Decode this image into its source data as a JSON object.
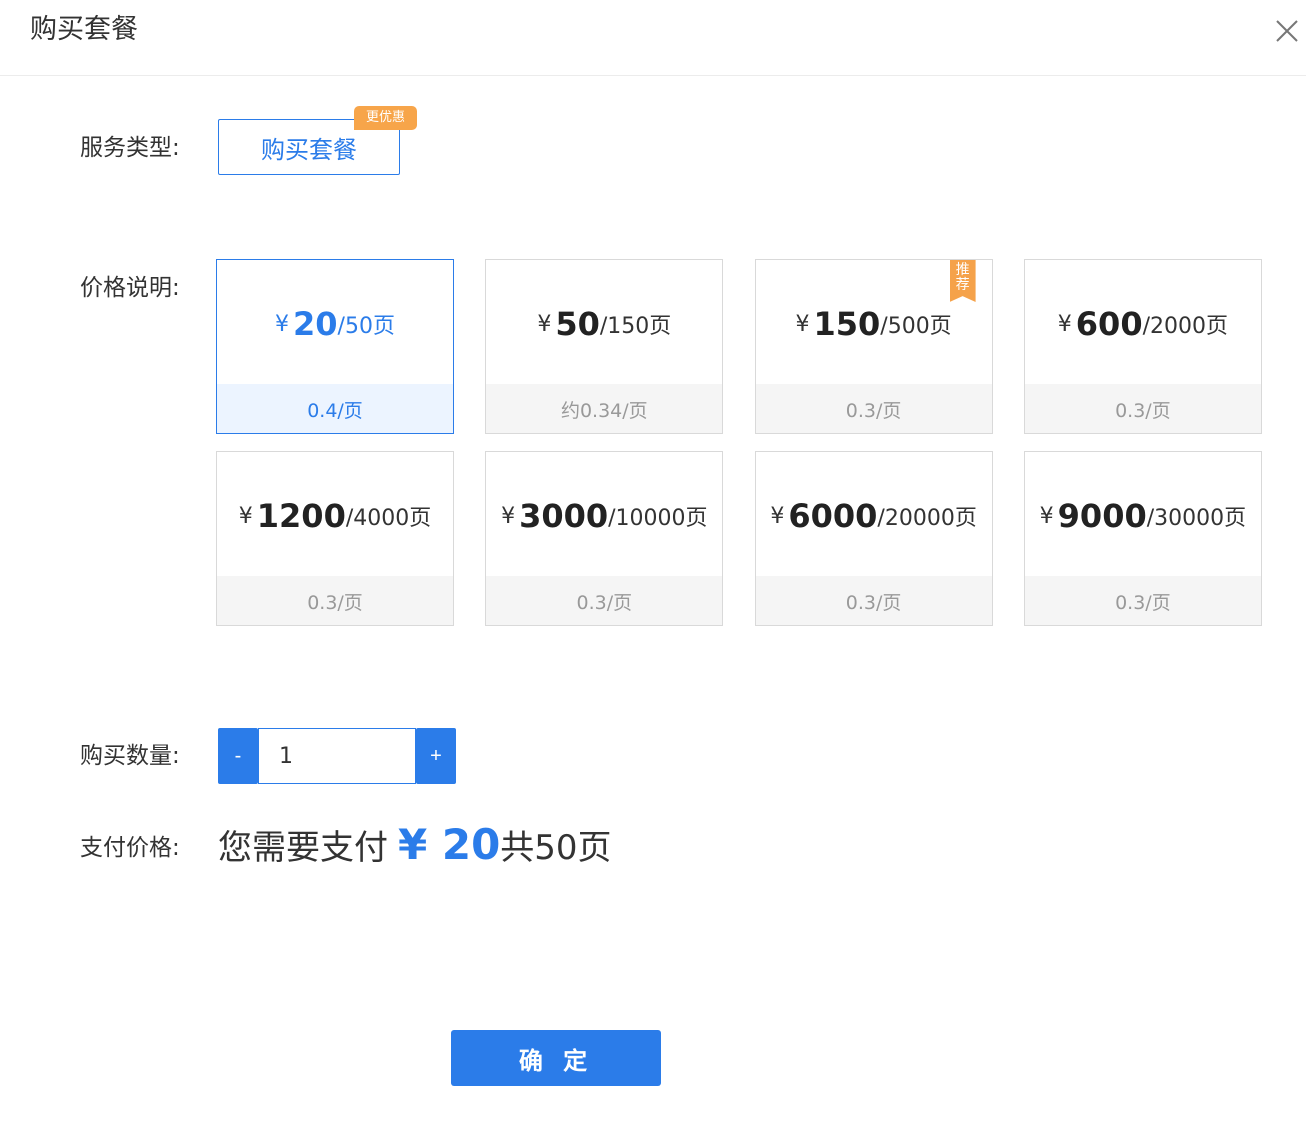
{
  "dialog": {
    "title": "购买套餐",
    "close_icon": "close-icon"
  },
  "service": {
    "label": "服务类型:",
    "button_label": "购买套餐",
    "badge": "更优惠"
  },
  "pricing": {
    "label": "价格说明:",
    "currency": "¥",
    "packages": [
      {
        "price": "20",
        "pages": "/50页",
        "unit": "0.4/页",
        "selected": true,
        "badge": ""
      },
      {
        "price": "50",
        "pages": "/150页",
        "unit": "约0.34/页",
        "selected": false,
        "badge": ""
      },
      {
        "price": "150",
        "pages": "/500页",
        "unit": "0.3/页",
        "selected": false,
        "badge": "推荐"
      },
      {
        "price": "600",
        "pages": "/2000页",
        "unit": "0.3/页",
        "selected": false,
        "badge": ""
      },
      {
        "price": "1200",
        "pages": "/4000页",
        "unit": "0.3/页",
        "selected": false,
        "badge": ""
      },
      {
        "price": "3000",
        "pages": "/10000页",
        "unit": "0.3/页",
        "selected": false,
        "badge": ""
      },
      {
        "price": "6000",
        "pages": "/20000页",
        "unit": "0.3/页",
        "selected": false,
        "badge": ""
      },
      {
        "price": "9000",
        "pages": "/30000页",
        "unit": "0.3/页",
        "selected": false,
        "badge": ""
      }
    ]
  },
  "quantity": {
    "label": "购买数量:",
    "minus": "-",
    "plus": "+",
    "value": "1"
  },
  "payment": {
    "label": "支付价格:",
    "prefix": "您需要支付",
    "amount": "¥ 20",
    "suffix": "共50页"
  },
  "confirm_label": "确 定",
  "colors": {
    "accent": "#2b7ce9",
    "badge": "#f7a54a",
    "selected_bg": "#ecf4ff",
    "muted_bg": "#f5f5f5"
  }
}
